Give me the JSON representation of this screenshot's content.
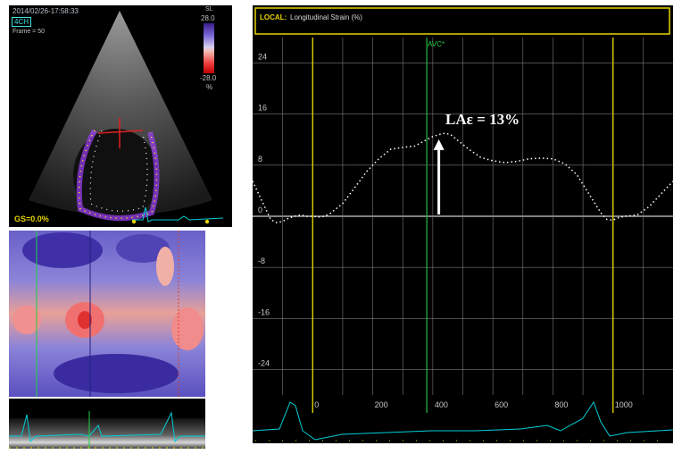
{
  "echo": {
    "timestamp": "2014/02/26-17:58:33",
    "view": "4CH",
    "frame_label": "Frame = 50",
    "scale_unit_top": "SL",
    "scale_max": "28.0",
    "scale_min": "-28.0",
    "scale_unit": "%",
    "global_strain": "GS=0.0%"
  },
  "graph": {
    "header_prefix": "LOCAL:",
    "header_title": "Longitudinal Strain (%)",
    "avc_label": "AVC*",
    "annotation": "LAε = 13%",
    "y_ticks": [
      "24",
      "16",
      "8",
      "0",
      "-8",
      "-16",
      "-24"
    ],
    "x_ticks": [
      "0",
      "200",
      "400",
      "600",
      "800",
      "1000"
    ]
  },
  "chart_data": {
    "type": "line",
    "title": "Longitudinal Strain (%)",
    "xlabel": "",
    "ylabel": "",
    "xlim": [
      -200,
      1200
    ],
    "ylim": [
      -28,
      28
    ],
    "y_ticks": [
      24,
      16,
      8,
      0,
      -8,
      -16,
      -24
    ],
    "x_ticks": [
      0,
      200,
      400,
      600,
      800,
      1000
    ],
    "grid": true,
    "markers": {
      "avc": 380,
      "cycle_start": 0,
      "cycle_end": 1000
    },
    "peak": {
      "x": 440,
      "y": 13
    },
    "series": [
      {
        "x": [
          -200,
          -180,
          -160,
          -140,
          -120,
          -100,
          -80,
          -60,
          -40,
          -20,
          0,
          20,
          40,
          60,
          100,
          140,
          180,
          220,
          260,
          300,
          340,
          380,
          400,
          420,
          440,
          460,
          480,
          520,
          560,
          600,
          640,
          680,
          720,
          760,
          800,
          840,
          880,
          920,
          960,
          980,
          1000,
          1020,
          1040,
          1080,
          1120,
          1160,
          1200
        ],
        "y": [
          5.5,
          3.5,
          1.5,
          -0.5,
          -1.0,
          -0.8,
          -0.3,
          0,
          0.2,
          0,
          0,
          -0.1,
          0,
          0.5,
          2,
          4.5,
          7,
          9,
          10.5,
          10.8,
          11,
          12,
          12.5,
          12.8,
          13,
          12.8,
          12,
          10.5,
          9.2,
          8.7,
          8.4,
          8.6,
          9,
          9.1,
          9,
          8.2,
          6.5,
          3.5,
          0.5,
          -0.5,
          -0.6,
          -0.2,
          0,
          0.2,
          1.5,
          3.5,
          5.5
        ]
      }
    ]
  },
  "colors": {
    "grid": "#7a7a7a",
    "marker_line": "#e0d000",
    "avc_line": "#1fa03a",
    "curve": "#ffffff",
    "header": "#e8d400",
    "ecg": "#00d0d8"
  }
}
